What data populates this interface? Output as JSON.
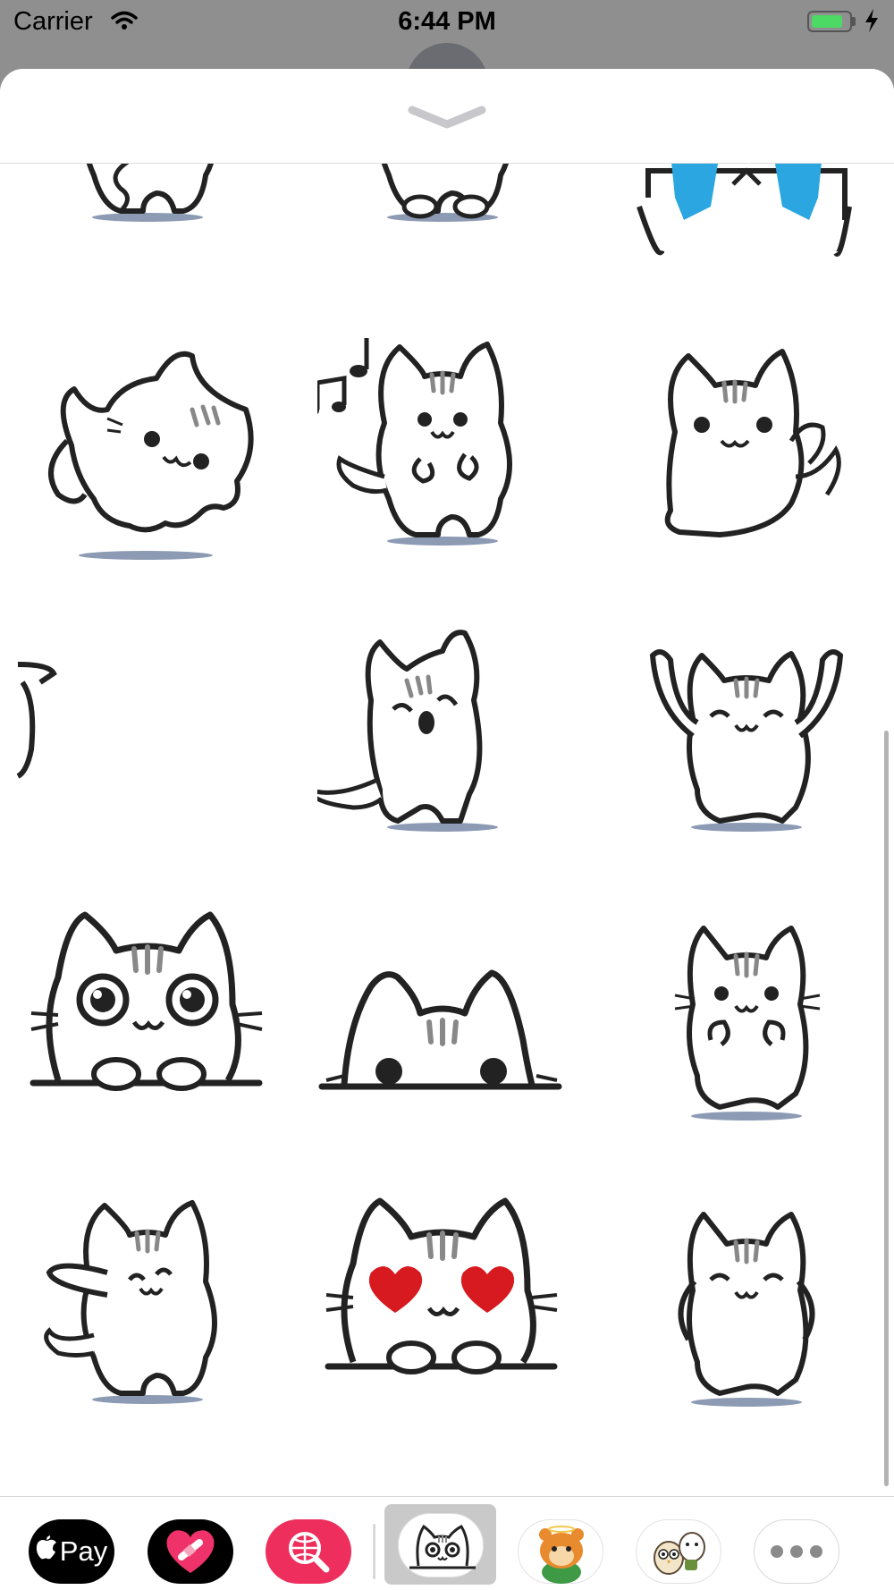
{
  "status_bar": {
    "carrier": "Carrier",
    "time": "6:44 PM",
    "battery_level": 0.85
  },
  "sticker_pack": {
    "stickers": [
      {
        "name": "cat-sticker-top-left"
      },
      {
        "name": "cat-sticker-top-middle"
      },
      {
        "name": "cat-sticker-crying"
      },
      {
        "name": "cat-sticker-jumping"
      },
      {
        "name": "cat-sticker-singing"
      },
      {
        "name": "cat-sticker-waving"
      },
      {
        "name": "cat-sticker-partial"
      },
      {
        "name": "cat-sticker-laughing"
      },
      {
        "name": "cat-sticker-arms-up"
      },
      {
        "name": "cat-sticker-big-eyes"
      },
      {
        "name": "cat-sticker-peeking"
      },
      {
        "name": "cat-sticker-standing"
      },
      {
        "name": "cat-sticker-dabbing"
      },
      {
        "name": "cat-sticker-heart-eyes"
      },
      {
        "name": "cat-sticker-hands-on-hips"
      }
    ]
  },
  "tray": {
    "apps": [
      {
        "name": "Apple Pay",
        "label": "Pay"
      },
      {
        "name": "heart-app"
      },
      {
        "name": "search-app"
      },
      {
        "name": "cat-sticker-app",
        "selected": true
      },
      {
        "name": "hamster-sticker-app"
      },
      {
        "name": "owl-sticker-app"
      },
      {
        "name": "more-apps"
      }
    ]
  },
  "colors": {
    "accent_pink": "#ee2f5d",
    "battery_green": "#4cd964",
    "tear_blue": "#2ba6e0",
    "heart_red": "#d71920"
  }
}
